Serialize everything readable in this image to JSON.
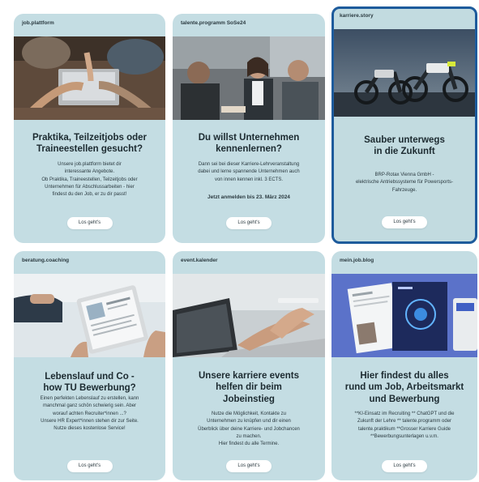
{
  "cards": [
    {
      "tag": "job.plattform",
      "title": "Praktika, Teilzeitjobs oder\nTraineestellen gesucht?",
      "body": "Unsere job.plattform bietet dir\ninteressante Angebote.\nOb Praktika, Traineestellen, Teilzeitjobs oder\nUnternehmen für Abschlussarbeiten - hier\nfindest du den Job, er zu dir passt!",
      "note": "",
      "button": "Los geht's"
    },
    {
      "tag": "talente.programm SoSe24",
      "title": "Du willst Unternehmen\nkennenlernen?",
      "body": "Dann sei bei dieser Karriere-Lehrveranstaltung\ndabei und lerne spannende Unternehmen auch\nvon innen kennen inkl. 3 ECTS.",
      "note": "Jetzt anmelden bis 23. März 2024",
      "button": "Los geht's"
    },
    {
      "tag": "karriere.story",
      "title": "Sauber unterwegs\nin die Zukunft",
      "body": "BRP-Rotax Vienna GmbH -\nelektrische Antriebssysteme für Powersports-\nFahrzeuge.",
      "note": "",
      "button": "Los geht's"
    },
    {
      "tag": "beratung.coaching",
      "title": "Lebenslauf und Co -\nhow TU Bewerbung?",
      "body": "Einen perfekten Lebenslauf zu erstellen, kann\nmanchmal ganz schön schwierig sein. Aber\nworauf achten Recruiter*innen ...?\nUnsere HR Expert*innen stehen dir zur Seite.\nNutze dieses kostenlose Service!",
      "note": "",
      "button": "Los geht's"
    },
    {
      "tag": "event.kalender",
      "title": "Unsere karriere events\nhelfen dir beim\nJobeinstieg",
      "body": "Nutze die Möglichkeit, Kontakte zu\nUnternehmen zu knüpfen und dir einen\nÜberblick über deine Karriere- und Jobchancen\nzu machen.\nHier findest du alle Termine.",
      "note": "",
      "button": "Los geht's"
    },
    {
      "tag": "mein.job.blog",
      "title": "Hier findest du alles\nrund um Job, Arbeitsmarkt\nund Bewerbung",
      "body": "**KI-Einsatz im Recruiting ** ChatGPT und die\nZukunft der Lehre ** talente.programm oder\ntalente.praktikum **Grosser Karriere Guide\n**Bewerbungsunterlagen u.v.m.",
      "note": "",
      "button": "Los geht's"
    }
  ],
  "colors": {
    "card_bg": "#c4dde3",
    "highlight_border": "#1d5b9c",
    "button_bg": "#ffffff"
  }
}
